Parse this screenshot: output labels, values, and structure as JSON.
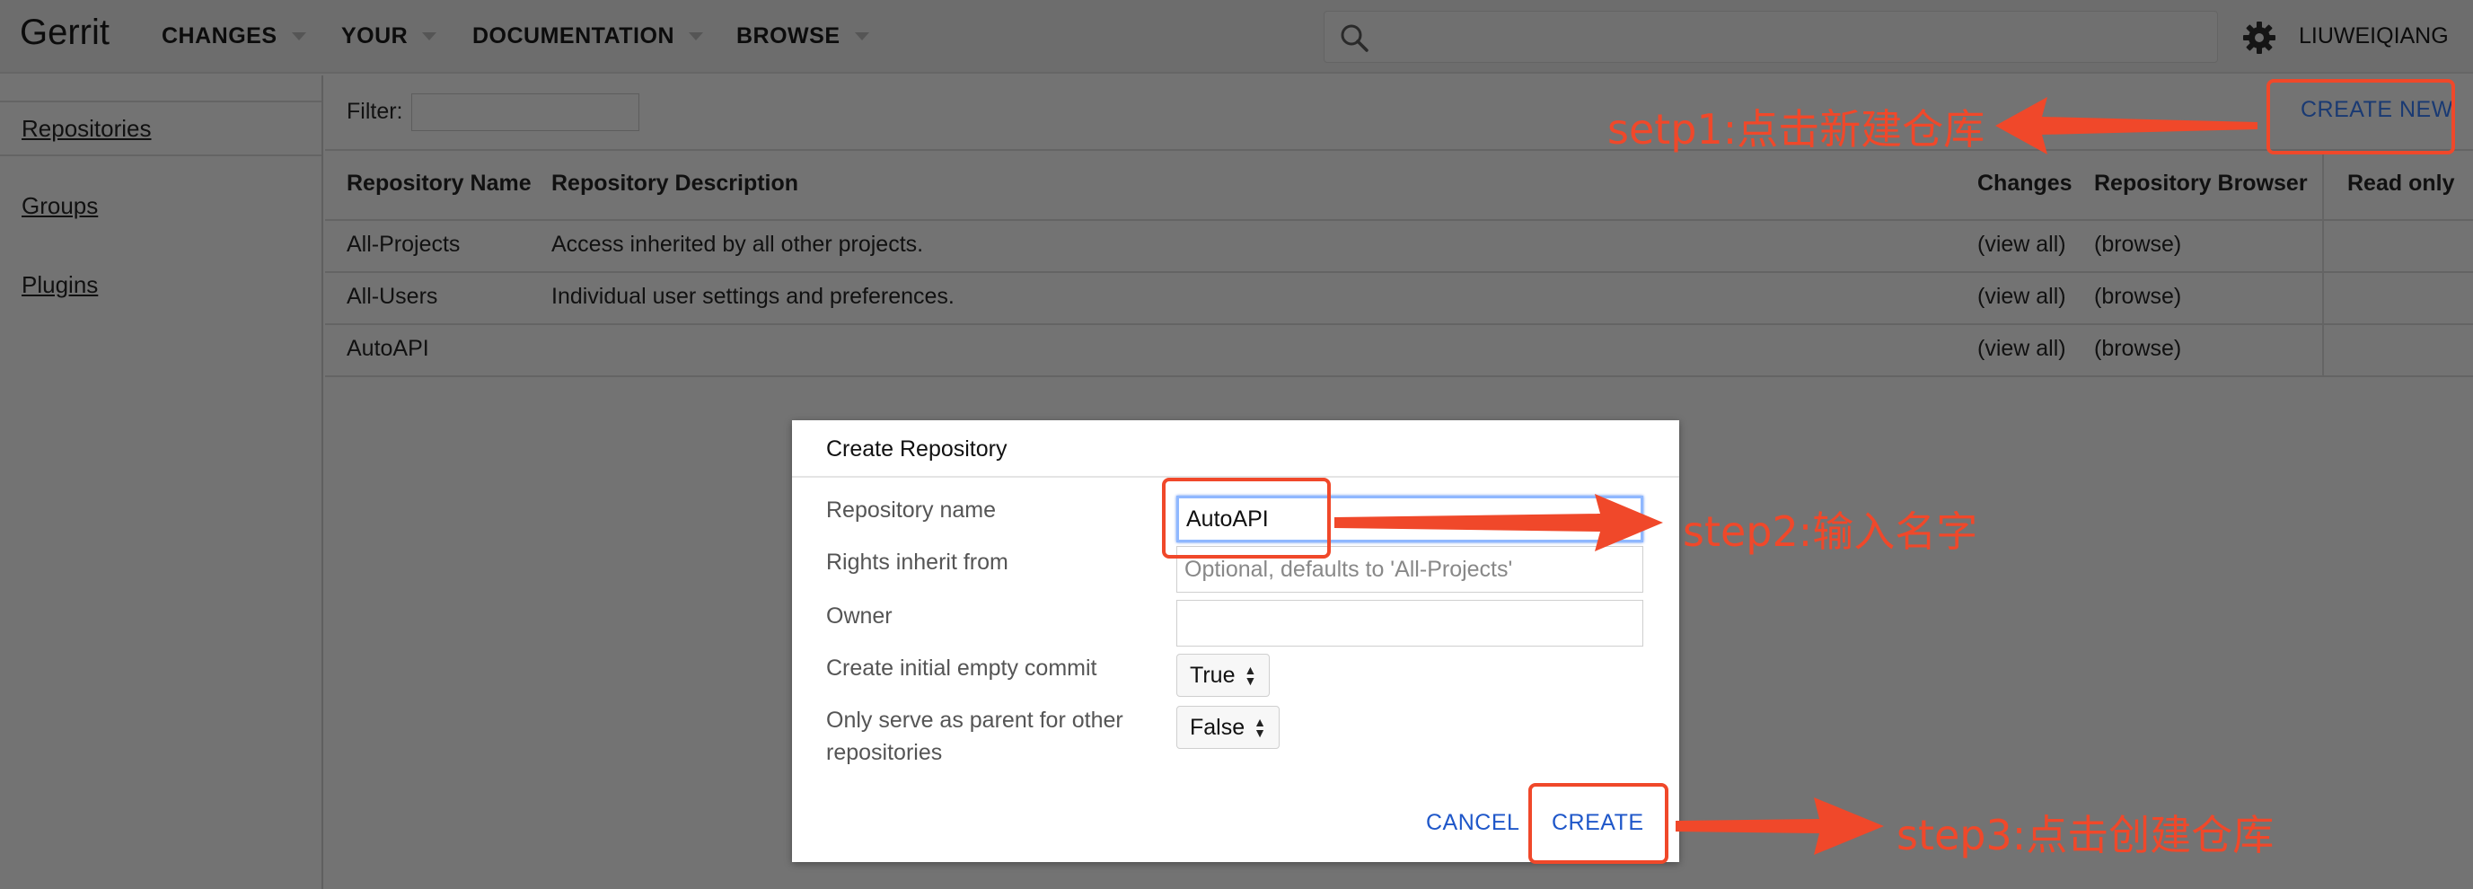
{
  "header": {
    "brand": "Gerrit",
    "menus": [
      {
        "label": "CHANGES"
      },
      {
        "label": "YOUR"
      },
      {
        "label": "DOCUMENTATION"
      },
      {
        "label": "BROWSE"
      }
    ],
    "search": {
      "value": "",
      "placeholder": ""
    },
    "user": "LIUWEIQIANG"
  },
  "sidebar": {
    "items": [
      {
        "label": "Repositories"
      },
      {
        "label": "Groups"
      },
      {
        "label": "Plugins"
      }
    ]
  },
  "main": {
    "filter_label": "Filter:",
    "filter_value": "",
    "create_new": "CREATE NEW",
    "columns": [
      "Repository Name",
      "Repository Description",
      "Changes",
      "Repository Browser",
      "Read only"
    ],
    "rows": [
      {
        "name": "All-Projects",
        "description": "Access inherited by all other projects.",
        "changes": "(view all)",
        "browser": "(browse)",
        "read_only": ""
      },
      {
        "name": "All-Users",
        "description": "Individual user settings and preferences.",
        "changes": "(view all)",
        "browser": "(browse)",
        "read_only": ""
      },
      {
        "name": "AutoAPI",
        "description": "",
        "changes": "(view all)",
        "browser": "(browse)",
        "read_only": ""
      }
    ]
  },
  "dialog": {
    "title": "Create Repository",
    "fields": {
      "repo_name_label": "Repository name",
      "repo_name_value": "AutoAPI",
      "rights_label": "Rights inherit from",
      "rights_placeholder": "Optional, defaults to 'All-Projects'",
      "owner_label": "Owner",
      "owner_value": "",
      "initial_commit_label": "Create initial empty commit",
      "initial_commit_value": "True",
      "parent_label_line1": "Only serve as parent for other",
      "parent_label_line2": "repositories",
      "parent_value": "False"
    },
    "cancel": "CANCEL",
    "create": "CREATE"
  },
  "annotations": {
    "step1": "setp1:点击新建仓库",
    "step2": "step2:输入名字",
    "step3": "step3:点击创建仓库",
    "color": "#f0482a"
  }
}
